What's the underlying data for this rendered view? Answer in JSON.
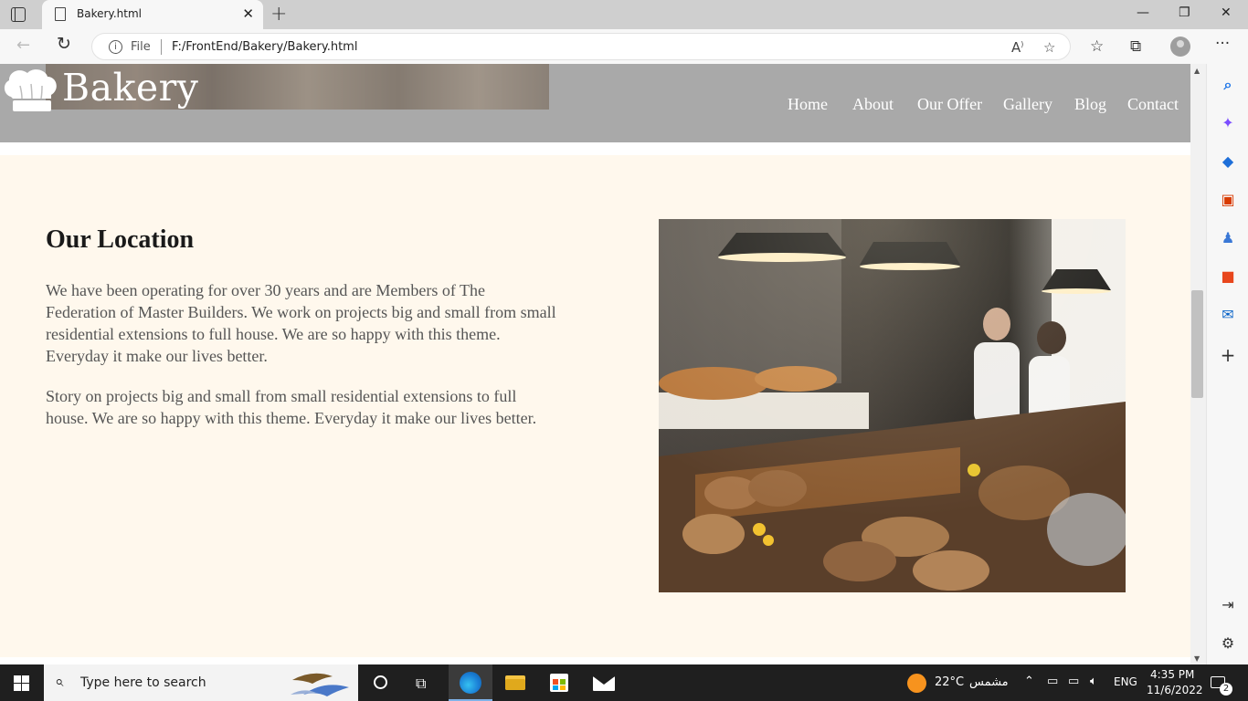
{
  "browser": {
    "tab_title": "Bakery.html",
    "tab_close": "✕",
    "new_tab": "+",
    "window_controls": {
      "minimize": "—",
      "maximize": "❐",
      "close": "✕"
    },
    "address_scheme": "File",
    "address_url": "F:/FrontEnd/Bakery/Bakery.html",
    "back_icon": "←",
    "reload_icon": "↻"
  },
  "site": {
    "brand": "Bakery",
    "nav": [
      "Home",
      "About",
      "Our Offer",
      "Gallery",
      "Blog",
      "Contact"
    ]
  },
  "location": {
    "title": "Our Location",
    "paragraphs": [
      "We have been operating for over 30 years and are Members of The Federation of Master Builders. We work on projects big and small from small residential extensions to full house. We are so happy with this theme. Everyday it make our lives better.",
      "Story on projects big and small from small residential extensions to full house. We are so happy with this theme. Everyday it make our lives better."
    ]
  },
  "taskbar": {
    "search_placeholder": "Type here to search",
    "weather_temp": "22°C",
    "weather_desc": "مشمس",
    "language": "ENG",
    "time": "4:35 PM",
    "date": "11/6/2022",
    "notification_count": "2"
  },
  "colors": {
    "header_bg": "#a9a9a9",
    "section_bg": "#fff8ed",
    "taskbar_bg": "#1f1f1f"
  }
}
